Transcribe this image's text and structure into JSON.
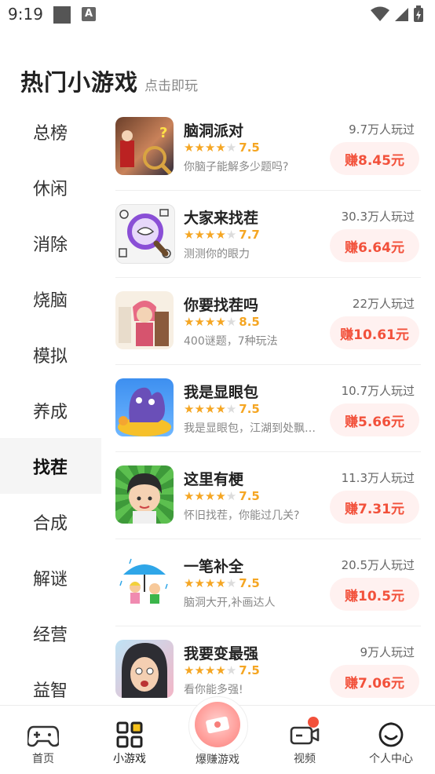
{
  "status_bar": {
    "time": "9:19",
    "notification_icon_letter": "A"
  },
  "header": {
    "title": "热门小游戏",
    "subtitle": "点击即玩"
  },
  "sidebar": {
    "items": [
      {
        "label": "总榜",
        "active": false
      },
      {
        "label": "休闲",
        "active": false
      },
      {
        "label": "消除",
        "active": false
      },
      {
        "label": "烧脑",
        "active": false
      },
      {
        "label": "模拟",
        "active": false
      },
      {
        "label": "养成",
        "active": false
      },
      {
        "label": "找茬",
        "active": true
      },
      {
        "label": "合成",
        "active": false
      },
      {
        "label": "解谜",
        "active": false
      },
      {
        "label": "经营",
        "active": false
      },
      {
        "label": "益智",
        "active": false
      }
    ]
  },
  "games": [
    {
      "name": "脑洞派对",
      "rating": "7.5",
      "stars": 3.5,
      "desc": "你脑子能解多少题吗?",
      "plays": "9.7万人玩过",
      "earn": "赚8.45元",
      "icon": "detective-scene-thumbnail"
    },
    {
      "name": "大家来找茬",
      "rating": "7.7",
      "stars": 3.5,
      "desc": "测测你的眼力",
      "plays": "30.3万人玩过",
      "earn": "赚6.64元",
      "icon": "magnifier-doodle-thumbnail"
    },
    {
      "name": "你要找茬吗",
      "rating": "8.5",
      "stars": 4,
      "desc": "400谜题，7种玩法",
      "plays": "22万人玩过",
      "earn": "赚10.61元",
      "icon": "pink-hair-girl-thumbnail"
    },
    {
      "name": "我是显眼包",
      "rating": "7.5",
      "stars": 3.5,
      "desc": "我是显眼包，江湖到处飘…",
      "plays": "10.7万人玩过",
      "earn": "赚5.66元",
      "icon": "purple-blob-thumbnail"
    },
    {
      "name": "这里有梗",
      "rating": "7.5",
      "stars": 3.5,
      "desc": "怀旧找茬，你能过几关?",
      "plays": "11.3万人玩过",
      "earn": "赚7.31元",
      "icon": "crying-girl-thumbnail"
    },
    {
      "name": "一笔补全",
      "rating": "7.5",
      "stars": 3.5,
      "desc": "脑洞大开,补画达人",
      "plays": "20.5万人玩过",
      "earn": "赚10.5元",
      "icon": "umbrella-kids-thumbnail"
    },
    {
      "name": "我要变最强",
      "rating": "7.5",
      "stars": 3.5,
      "desc": "看你能多强!",
      "plays": "9万人玩过",
      "earn": "赚7.06元",
      "icon": "shocked-woman-thumbnail"
    }
  ],
  "bottom_nav": {
    "items": [
      {
        "label": "首页",
        "icon": "gamepad-icon"
      },
      {
        "label": "小游戏",
        "icon": "grid-icon",
        "active": true
      },
      {
        "label": "爆赚游戏",
        "icon": "money-icon"
      },
      {
        "label": "视频",
        "icon": "video-icon",
        "badge": true
      },
      {
        "label": "个人中心",
        "icon": "smile-face-icon"
      }
    ]
  },
  "colors": {
    "accent": "#f2513b",
    "star": "#f5a623",
    "earn_bg": "#fff1f0"
  }
}
